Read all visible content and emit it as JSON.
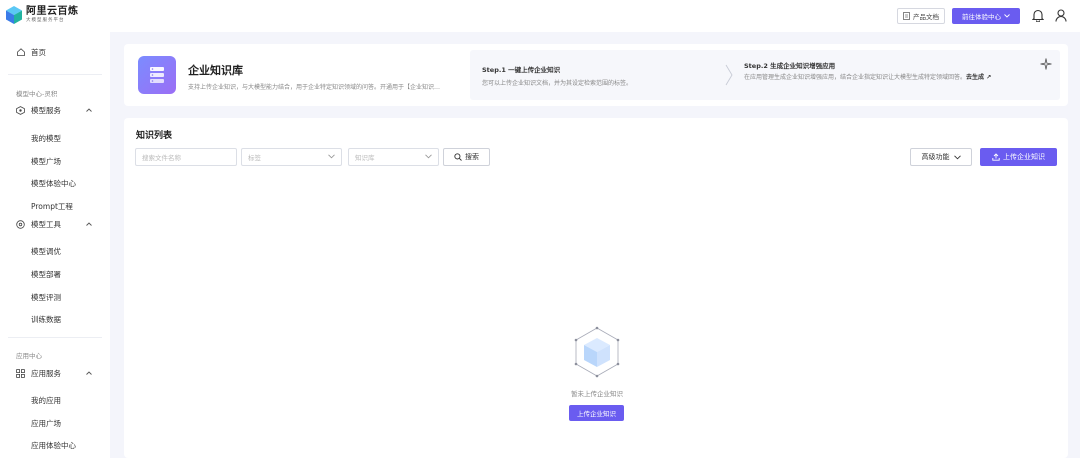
{
  "header": {
    "brand_title": "阿里云百炼",
    "brand_sub": "大模型服务平台",
    "docs_label": "产品文档",
    "experience_label": "前往体验中心",
    "brand_color": "#6a5cf0"
  },
  "sidebar": {
    "home": "首页",
    "section_model": "模型中心-灵积",
    "model_service": "模型服务",
    "model_service_items": [
      "我的模型",
      "模型广场",
      "模型体验中心",
      "Prompt工程"
    ],
    "model_tools": "模型工具",
    "model_tools_items": [
      "模型调优",
      "模型部署",
      "模型评测",
      "训练数据"
    ],
    "section_app": "应用中心",
    "app_service": "应用服务",
    "app_service_items": [
      "我的应用",
      "应用广场",
      "应用体验中心"
    ]
  },
  "banner": {
    "title": "企业知识库",
    "desc": "支持上传企业知识，与大模型能力结合，用于企业特定知识领域的问答。开通用于【企业知识…",
    "step1_title": "Step.1 一键上传企业知识",
    "step1_desc": "您可以上传企业知识文档，并为其设定检索范围的标签。",
    "step2_title": "Step.2 生成企业知识增强应用",
    "step2_desc": "在应用管理生成企业知识增强应用，结合企业指定知识让大模型生成特定领域回答。",
    "step2_link": "去生成 ↗"
  },
  "list": {
    "title": "知识列表",
    "search_placeholder": "搜索文件名称",
    "tag_placeholder": "标签",
    "kb_placeholder": "知识库",
    "search_button": "搜索",
    "advanced_button": "高级功能",
    "upload_button": "上传企业知识",
    "empty_text": "暂未上传企业知识",
    "empty_upload_button": "上传企业知识"
  }
}
